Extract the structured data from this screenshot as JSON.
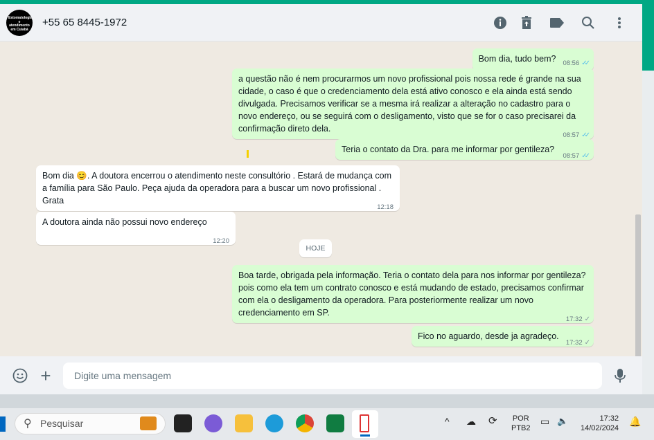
{
  "header": {
    "avatar_text": "Estomatologia e atendimento em Cuiabá",
    "contact": "+55 65 8445-1972",
    "icons": [
      "info-icon",
      "trash-icon",
      "label-icon",
      "search-icon",
      "menu-icon"
    ]
  },
  "messages": [
    {
      "dir": "out",
      "text": "Bom dia, tudo bem?",
      "time": "08:56",
      "status": "read"
    },
    {
      "dir": "out",
      "text": "a questão não é nem procurarmos um novo profissional pois nossa rede é grande na sua cidade, o caso é que o credenciamento dela está ativo conosco e ela ainda está sendo divulgada. Precisamos verificar se a mesma irá realizar a alteração no cadastro para o novo endereço, ou se seguirá com o desligamento, visto que se for o caso precisarei da confirmação direto dela.",
      "time": "08:57",
      "status": "read"
    },
    {
      "dir": "out",
      "text": "Teria o contato da Dra. para me informar por gentileza?",
      "time": "08:57",
      "status": "read"
    },
    {
      "dir": "in",
      "text": "Bom dia 😊. A doutora encerrou o atendimento neste consultório . Estará de mudança com a família para São Paulo. Peça ajuda da operadora para a buscar  um novo profissional . Grata",
      "time": "12:18"
    },
    {
      "dir": "in",
      "text": "A doutora ainda não possui novo endereço",
      "time": "12:20"
    },
    {
      "dir": "out",
      "text": "Boa tarde, obrigada pela informação. Teria o contato dela para nos informar por gentileza? pois como ela tem um contrato conosco e está mudando de estado, precisamos confirmar com ela o desligamento da operadora. Para posteriormente realizar um novo credenciamento em SP.",
      "time": "17:32",
      "status": "sent"
    },
    {
      "dir": "out",
      "text": "Fico no aguardo, desde ja agradeço.",
      "time": "17:32",
      "status": "sent"
    }
  ],
  "day_divider": "HOJE",
  "footer": {
    "placeholder": "Digite uma mensagem"
  },
  "taskbar": {
    "search": "Pesquisar",
    "lang1": "POR",
    "lang2": "PTB2",
    "time": "17:32",
    "date": "14/02/2024"
  },
  "colors": {
    "accent": "#00a884",
    "outgoing": "#d9fdd3",
    "read_tick": "#53bdeb"
  }
}
